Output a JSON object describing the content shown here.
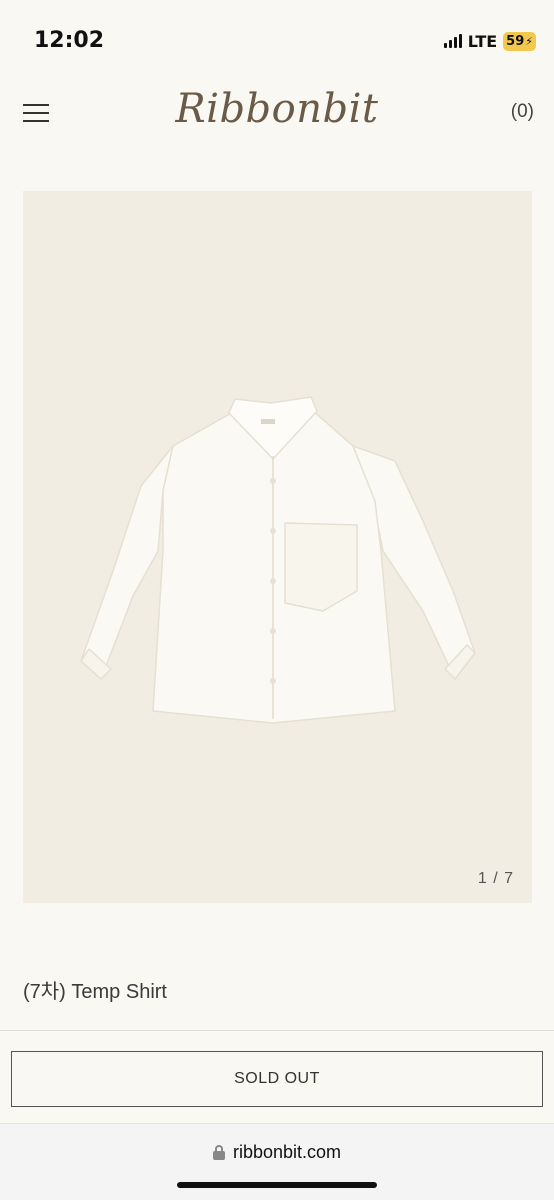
{
  "status_bar": {
    "time": "12:02",
    "network": "LTE",
    "battery": "59"
  },
  "header": {
    "logo": "Ribbonbit",
    "cart": "(0)"
  },
  "gallery": {
    "counter": "1 / 7"
  },
  "product": {
    "name": "(7차) Temp Shirt"
  },
  "actions": {
    "sold_out_label": "SOLD OUT"
  },
  "browser": {
    "url": "ribbonbit.com"
  },
  "colors": {
    "background": "#faf8f2",
    "gallery_background": "#f1ede2",
    "logo": "#6a5a48",
    "battery": "#f2c94c"
  }
}
